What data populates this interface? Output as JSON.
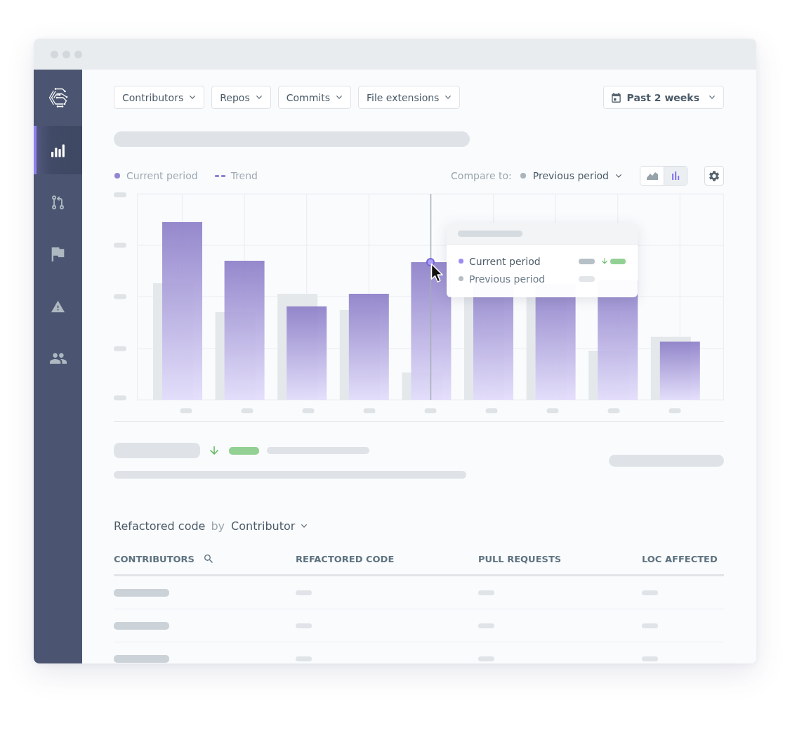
{
  "sidebar": {
    "items": [
      {
        "selected": true
      },
      {
        "selected": false
      },
      {
        "selected": false
      },
      {
        "selected": false
      },
      {
        "selected": false
      }
    ]
  },
  "filters": [
    "Contributors",
    "Repos",
    "Commits",
    "File extensions"
  ],
  "date_range": {
    "label": "Past 2 weeks"
  },
  "legend": [
    {
      "label": "Current period",
      "kind": "dot"
    },
    {
      "label": "Trend",
      "kind": "dash"
    }
  ],
  "compare": {
    "label": "Compare to:",
    "value": "Previous period"
  },
  "view_toggle": [
    {
      "selected": false
    },
    {
      "selected": true
    }
  ],
  "tooltip": {
    "rows": [
      {
        "label": "Current period",
        "color": "#9b8cf2",
        "decrease": true
      },
      {
        "label": "Previous period",
        "color": "#b4bec4",
        "decrease": false
      }
    ]
  },
  "summary": {
    "decrease": true
  },
  "breakdown": {
    "title": "Refactored code",
    "connector": "by",
    "group_by": "Contributor"
  },
  "table": {
    "columns": [
      {
        "label": "CONTRIBUTORS",
        "searchable": true
      },
      {
        "label": "REFACTORED CODE",
        "searchable": false
      },
      {
        "label": "PULL REQUESTS",
        "searchable": false
      },
      {
        "label": "LOC AFFECTED",
        "searchable": false
      }
    ]
  }
}
